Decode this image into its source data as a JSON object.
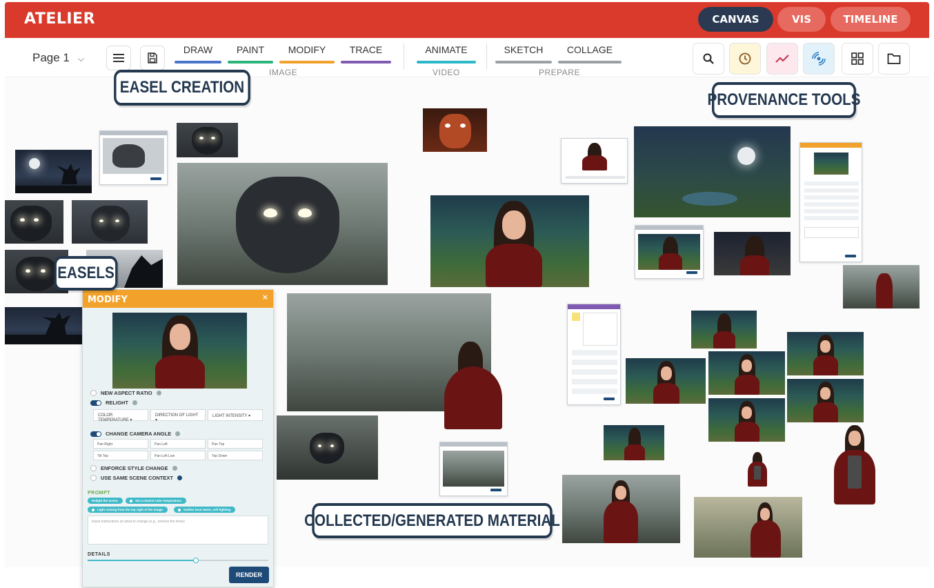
{
  "app": {
    "title": "ATELIER"
  },
  "modes": [
    {
      "label": "CANVAS",
      "active": true
    },
    {
      "label": "VIS",
      "active": false
    },
    {
      "label": "TIMELINE",
      "active": false
    }
  ],
  "toolbar": {
    "page": "Page 1",
    "tools": {
      "draw": "DRAW",
      "paint": "PAINT",
      "modify": "MODIFY",
      "trace": "TRACE",
      "animate": "ANIMATE",
      "sketch": "SKETCH",
      "collage": "COLLAGE"
    },
    "groups": {
      "image": "IMAGE",
      "video": "VIDEO",
      "prepare": "PREPARE"
    },
    "colors": {
      "draw": "#4a74c9",
      "paint": "#2bb57a",
      "modify": "#f2a22a",
      "trace": "#7f5ab0",
      "animate": "#2db8c9",
      "sketch": "#9aa0a6",
      "collage": "#9aa0a6"
    }
  },
  "callouts": {
    "easel_creation": "EASEL CREATION",
    "provenance_tools": "PROVENANCE TOOLS",
    "easels": "EASELS",
    "collected": "COLLECTED/GENERATED MATERIAL"
  },
  "modify_panel": {
    "title": "MODIFY",
    "close": "×",
    "options": {
      "new_aspect": "NEW ASPECT RATIO",
      "relight": "RELIGHT",
      "camera": "CHANGE CAMERA ANGLE",
      "style": "ENFORCE STYLE CHANGE",
      "scene": "USE SAME SCENE CONTEXT"
    },
    "relight_dropdowns": [
      "COLOR TEMPERATURE ▾",
      "DIRECTION OF LIGHT ▾",
      "LIGHT INTENSITY ▾"
    ],
    "camera_cells": [
      "Pan Right",
      "Pan Left",
      "Pan Top",
      "Tilt Top",
      "Pan Left Low",
      "Top Down"
    ],
    "prompt_label": "PROMPT",
    "chips": [
      "Relight the scene.",
      "Set a neutral color temperature.",
      "Light coming from the top right of the image.",
      "Golden hour warm, soft lighting."
    ],
    "placeholder": "Insert instructions on what to change (e.g., remove the trees)",
    "details_label": "DETAILS",
    "details_value": 0.6,
    "render_label": "RENDER"
  },
  "accent": {
    "header": "#d93a2b",
    "active_tab": "#2b3a52",
    "modify": "#f2a22a",
    "primary": "#1e4a78",
    "chip": "#3fb9c8"
  },
  "icons": [
    "menu-icon",
    "save-icon",
    "search-icon",
    "history-icon",
    "trend-icon",
    "provenance-icon",
    "grid-icon",
    "folder-icon"
  ]
}
